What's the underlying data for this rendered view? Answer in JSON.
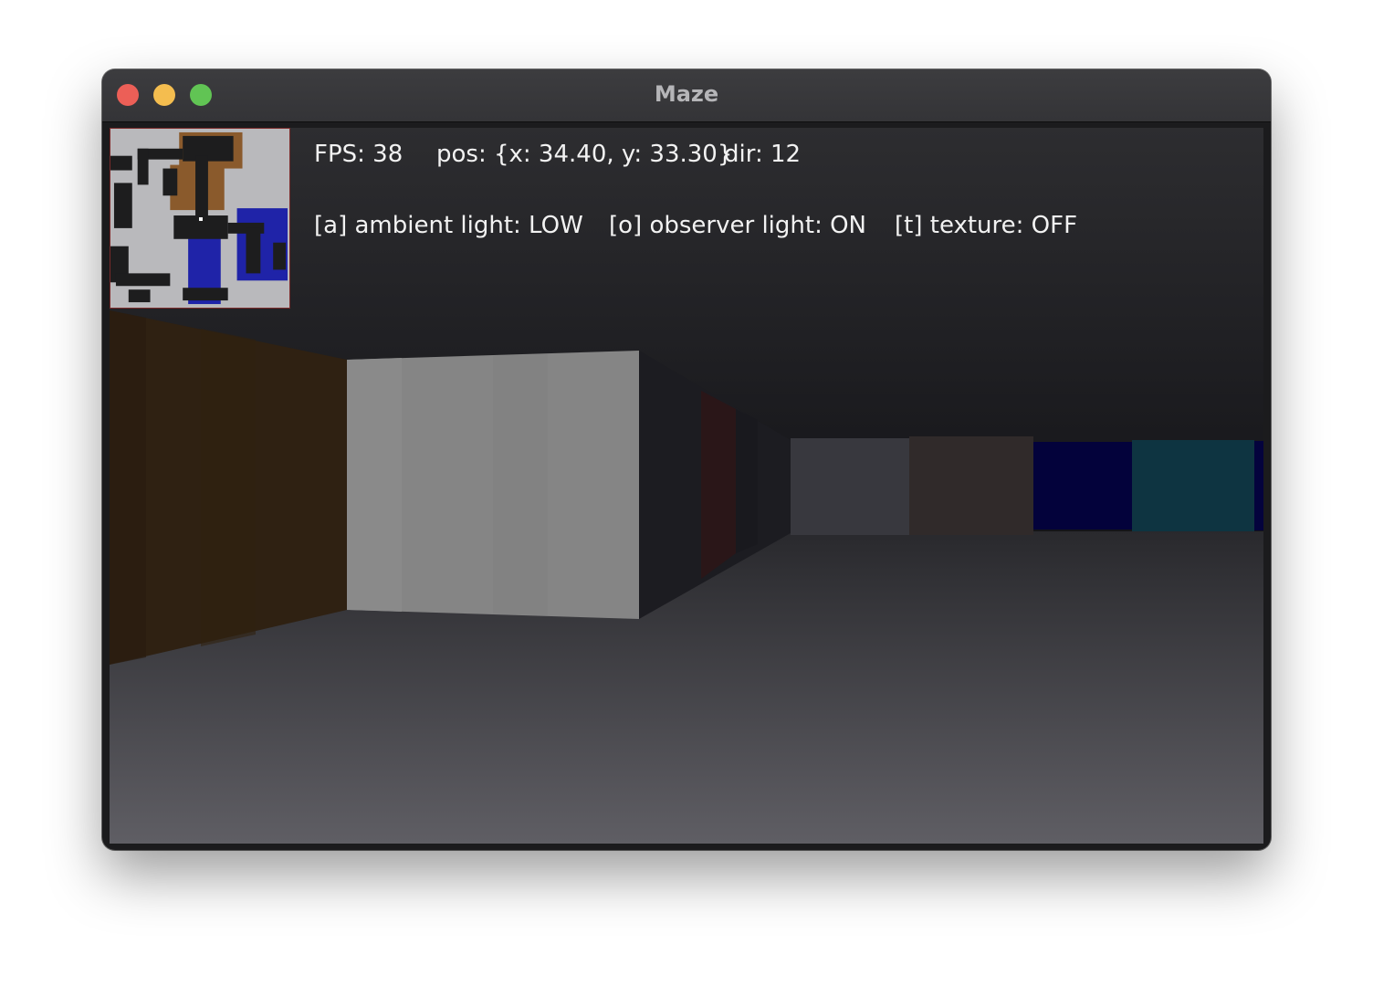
{
  "window": {
    "title": "Maze"
  },
  "hud": {
    "fps": "FPS: 38",
    "pos": "pos: {x: 34.40, y: 33.30}",
    "dir": "dir: 12",
    "ambient": "[a] ambient light: LOW",
    "observer": "[o] observer light: ON",
    "texture": "[t] texture: OFF"
  },
  "colors": {
    "close": "#ec5f57",
    "minimize": "#f4bd4f",
    "maximize": "#61c454",
    "ceiling_top": "#2c2c2f",
    "floor_bottom": "#5e5d63",
    "left_wall": "#2e2012",
    "center_wall": "#858585",
    "far_blue": "#02013a",
    "far_teal": "#0d3341"
  },
  "icons": [
    "close-icon",
    "minimize-icon",
    "maximize-icon"
  ]
}
